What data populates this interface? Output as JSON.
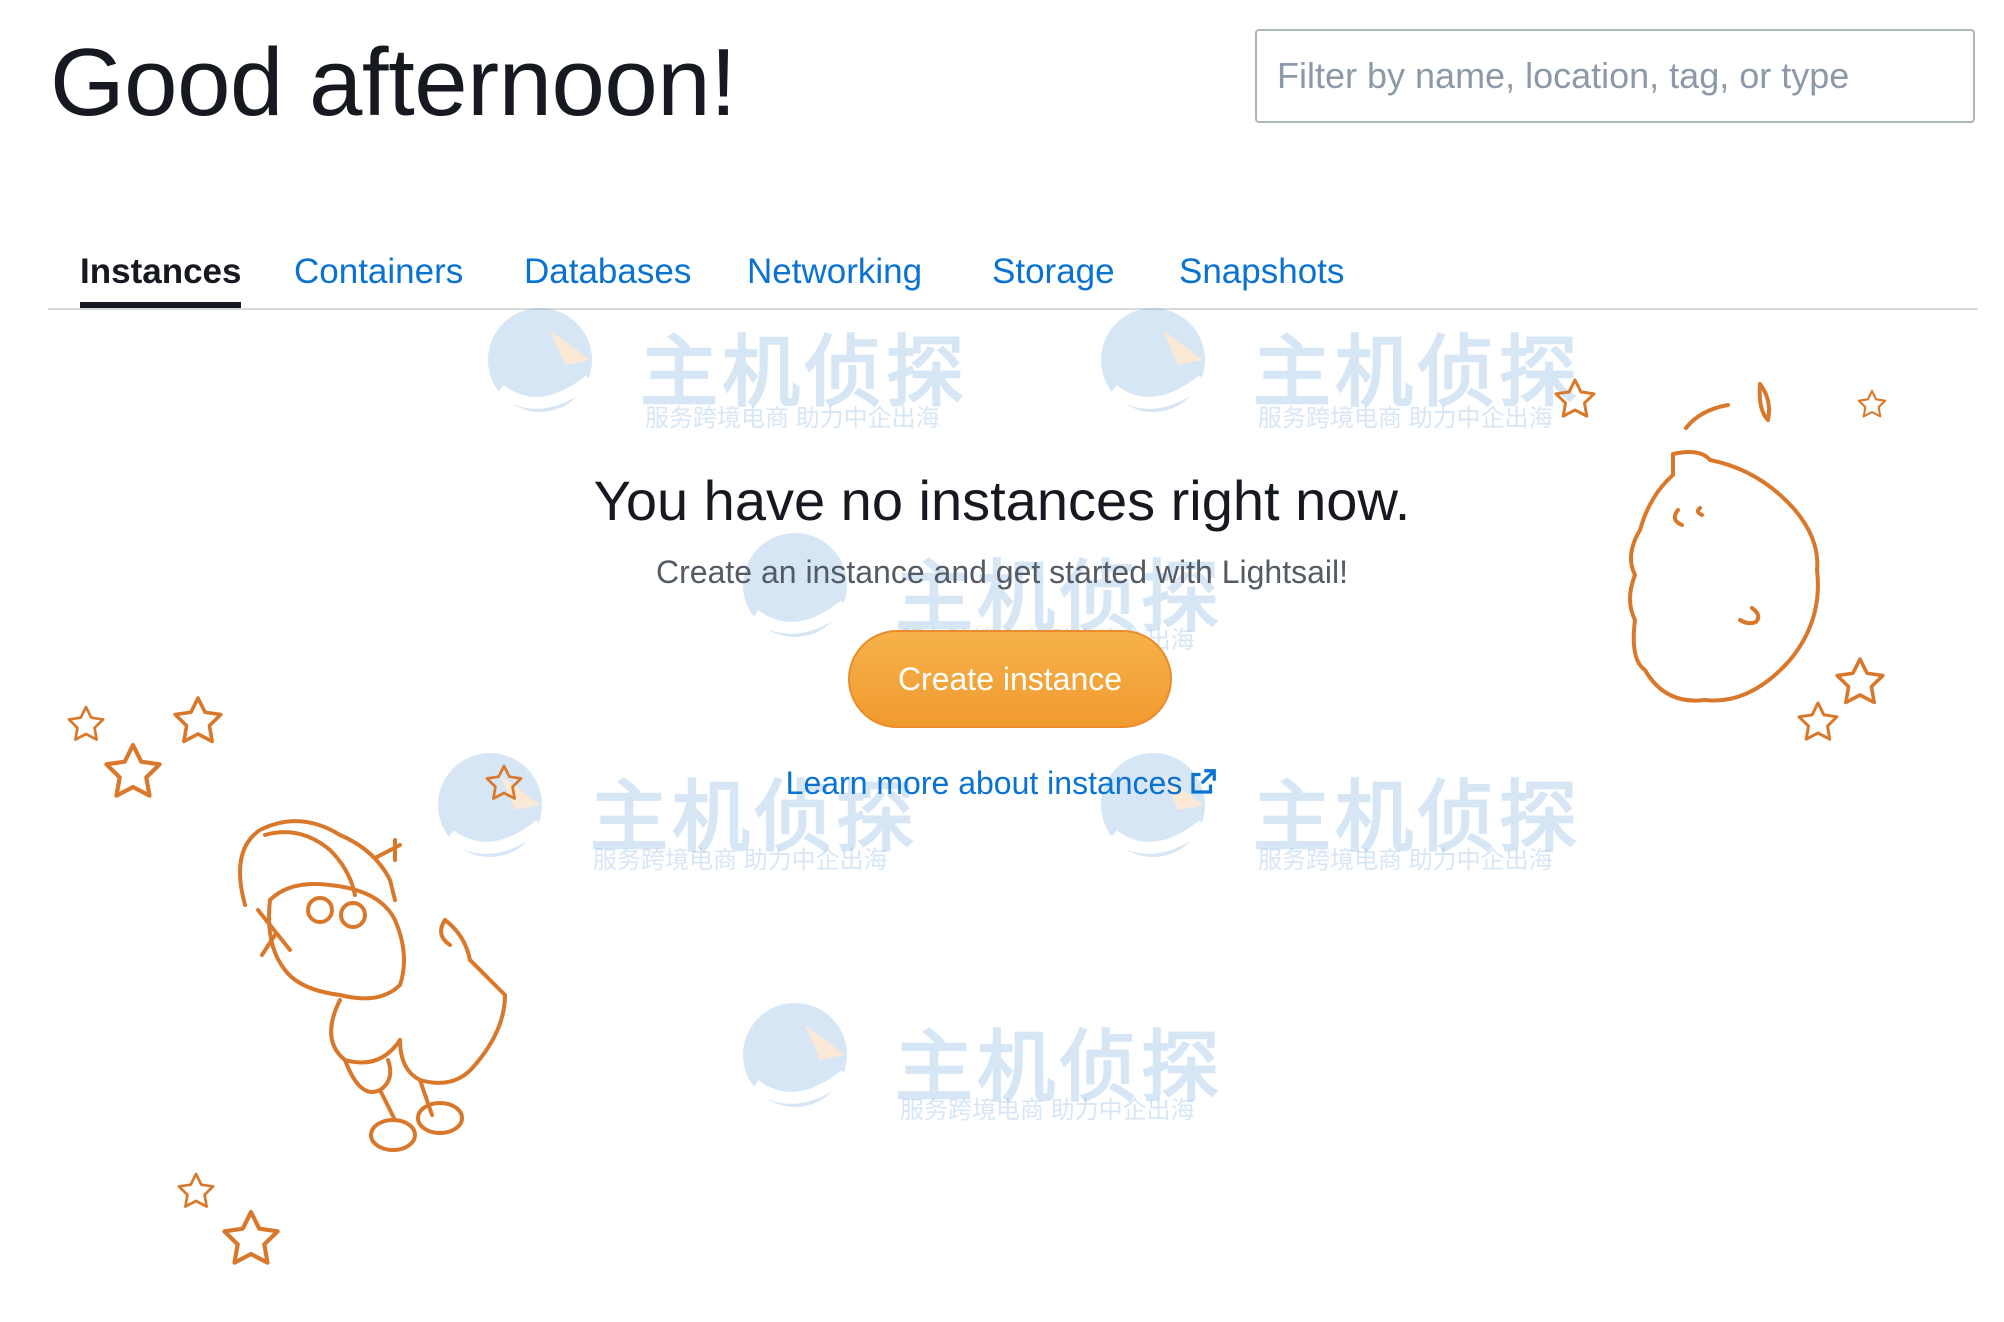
{
  "header": {
    "greeting": "Good afternoon!",
    "filter_placeholder": "Filter by name, location, tag, or type"
  },
  "tabs": [
    {
      "label": "Instances",
      "active": true
    },
    {
      "label": "Containers",
      "active": false
    },
    {
      "label": "Databases",
      "active": false
    },
    {
      "label": "Networking",
      "active": false
    },
    {
      "label": "Storage",
      "active": false
    },
    {
      "label": "Snapshots",
      "active": false
    }
  ],
  "empty_state": {
    "title": "You have no instances right now.",
    "subtitle": "Create an instance and get started with Lightsail!",
    "create_button": "Create instance",
    "learn_more_link": "Learn more about instances",
    "icon": "external-link-icon"
  },
  "watermark": {
    "brand": "主机侦探",
    "tagline": "服务跨境电商 助力中企出海"
  },
  "colors": {
    "accent_orange": "#f09a2f",
    "illustration_orange": "#d9782a",
    "link_blue": "#0972d3",
    "text_dark": "#16191f"
  }
}
